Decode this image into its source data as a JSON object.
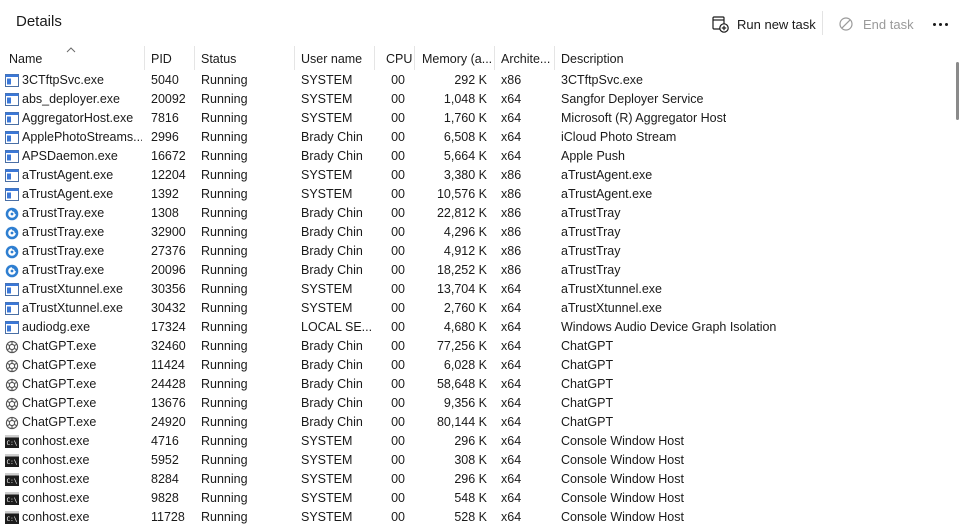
{
  "header": {
    "title": "Details",
    "run_new_task": "Run new task",
    "end_task": "End task"
  },
  "columns": {
    "name": "Name",
    "pid": "PID",
    "status": "Status",
    "user": "User name",
    "cpu": "CPU",
    "memory": "Memory (a...",
    "arch": "Archite...",
    "description": "Description"
  },
  "rows": [
    {
      "icon": "app-window-icon",
      "name": "3CTftpSvc.exe",
      "pid": "5040",
      "status": "Running",
      "user": "SYSTEM",
      "cpu": "00",
      "mem": "292 K",
      "arch": "x86",
      "desc": "3CTftpSvc.exe"
    },
    {
      "icon": "app-window-icon",
      "name": "abs_deployer.exe",
      "pid": "20092",
      "status": "Running",
      "user": "SYSTEM",
      "cpu": "00",
      "mem": "1,048 K",
      "arch": "x64",
      "desc": "Sangfor Deployer Service"
    },
    {
      "icon": "app-window-icon",
      "name": "AggregatorHost.exe",
      "pid": "7816",
      "status": "Running",
      "user": "SYSTEM",
      "cpu": "00",
      "mem": "1,760 K",
      "arch": "x64",
      "desc": "Microsoft (R) Aggregator Host"
    },
    {
      "icon": "app-window-icon",
      "name": "ApplePhotoStreams....",
      "pid": "2996",
      "status": "Running",
      "user": "Brady Chin",
      "cpu": "00",
      "mem": "6,508 K",
      "arch": "x64",
      "desc": "iCloud Photo Stream"
    },
    {
      "icon": "app-window-icon",
      "name": "APSDaemon.exe",
      "pid": "16672",
      "status": "Running",
      "user": "Brady Chin",
      "cpu": "00",
      "mem": "5,664 K",
      "arch": "x64",
      "desc": "Apple Push"
    },
    {
      "icon": "app-window-icon",
      "name": "aTrustAgent.exe",
      "pid": "12204",
      "status": "Running",
      "user": "SYSTEM",
      "cpu": "00",
      "mem": "3,380 K",
      "arch": "x86",
      "desc": "aTrustAgent.exe"
    },
    {
      "icon": "app-window-icon",
      "name": "aTrustAgent.exe",
      "pid": "1392",
      "status": "Running",
      "user": "SYSTEM",
      "cpu": "00",
      "mem": "10,576 K",
      "arch": "x86",
      "desc": "aTrustAgent.exe"
    },
    {
      "icon": "atrust-tray-icon",
      "name": "aTrustTray.exe",
      "pid": "1308",
      "status": "Running",
      "user": "Brady Chin",
      "cpu": "00",
      "mem": "22,812 K",
      "arch": "x86",
      "desc": "aTrustTray"
    },
    {
      "icon": "atrust-tray-icon",
      "name": "aTrustTray.exe",
      "pid": "32900",
      "status": "Running",
      "user": "Brady Chin",
      "cpu": "00",
      "mem": "4,296 K",
      "arch": "x86",
      "desc": "aTrustTray"
    },
    {
      "icon": "atrust-tray-icon",
      "name": "aTrustTray.exe",
      "pid": "27376",
      "status": "Running",
      "user": "Brady Chin",
      "cpu": "00",
      "mem": "4,912 K",
      "arch": "x86",
      "desc": "aTrustTray"
    },
    {
      "icon": "atrust-tray-icon",
      "name": "aTrustTray.exe",
      "pid": "20096",
      "status": "Running",
      "user": "Brady Chin",
      "cpu": "00",
      "mem": "18,252 K",
      "arch": "x86",
      "desc": "aTrustTray"
    },
    {
      "icon": "app-window-icon",
      "name": "aTrustXtunnel.exe",
      "pid": "30356",
      "status": "Running",
      "user": "SYSTEM",
      "cpu": "00",
      "mem": "13,704 K",
      "arch": "x64",
      "desc": "aTrustXtunnel.exe"
    },
    {
      "icon": "app-window-icon",
      "name": "aTrustXtunnel.exe",
      "pid": "30432",
      "status": "Running",
      "user": "SYSTEM",
      "cpu": "00",
      "mem": "2,760 K",
      "arch": "x64",
      "desc": "aTrustXtunnel.exe"
    },
    {
      "icon": "app-window-icon",
      "name": "audiodg.exe",
      "pid": "17324",
      "status": "Running",
      "user": "LOCAL SE...",
      "cpu": "00",
      "mem": "4,680 K",
      "arch": "x64",
      "desc": "Windows Audio Device Graph Isolation"
    },
    {
      "icon": "chatgpt-icon",
      "name": "ChatGPT.exe",
      "pid": "32460",
      "status": "Running",
      "user": "Brady Chin",
      "cpu": "00",
      "mem": "77,256 K",
      "arch": "x64",
      "desc": "ChatGPT"
    },
    {
      "icon": "chatgpt-icon",
      "name": "ChatGPT.exe",
      "pid": "11424",
      "status": "Running",
      "user": "Brady Chin",
      "cpu": "00",
      "mem": "6,028 K",
      "arch": "x64",
      "desc": "ChatGPT"
    },
    {
      "icon": "chatgpt-icon",
      "name": "ChatGPT.exe",
      "pid": "24428",
      "status": "Running",
      "user": "Brady Chin",
      "cpu": "00",
      "mem": "58,648 K",
      "arch": "x64",
      "desc": "ChatGPT"
    },
    {
      "icon": "chatgpt-icon",
      "name": "ChatGPT.exe",
      "pid": "13676",
      "status": "Running",
      "user": "Brady Chin",
      "cpu": "00",
      "mem": "9,356 K",
      "arch": "x64",
      "desc": "ChatGPT"
    },
    {
      "icon": "chatgpt-icon",
      "name": "ChatGPT.exe",
      "pid": "24920",
      "status": "Running",
      "user": "Brady Chin",
      "cpu": "00",
      "mem": "80,144 K",
      "arch": "x64",
      "desc": "ChatGPT"
    },
    {
      "icon": "console-icon",
      "name": "conhost.exe",
      "pid": "4716",
      "status": "Running",
      "user": "SYSTEM",
      "cpu": "00",
      "mem": "296 K",
      "arch": "x64",
      "desc": "Console Window Host"
    },
    {
      "icon": "console-icon",
      "name": "conhost.exe",
      "pid": "5952",
      "status": "Running",
      "user": "SYSTEM",
      "cpu": "00",
      "mem": "308 K",
      "arch": "x64",
      "desc": "Console Window Host"
    },
    {
      "icon": "console-icon",
      "name": "conhost.exe",
      "pid": "8284",
      "status": "Running",
      "user": "SYSTEM",
      "cpu": "00",
      "mem": "296 K",
      "arch": "x64",
      "desc": "Console Window Host"
    },
    {
      "icon": "console-icon",
      "name": "conhost.exe",
      "pid": "9828",
      "status": "Running",
      "user": "SYSTEM",
      "cpu": "00",
      "mem": "548 K",
      "arch": "x64",
      "desc": "Console Window Host"
    },
    {
      "icon": "console-icon",
      "name": "conhost.exe",
      "pid": "11728",
      "status": "Running",
      "user": "SYSTEM",
      "cpu": "00",
      "mem": "528 K",
      "arch": "x64",
      "desc": "Console Window Host"
    }
  ]
}
